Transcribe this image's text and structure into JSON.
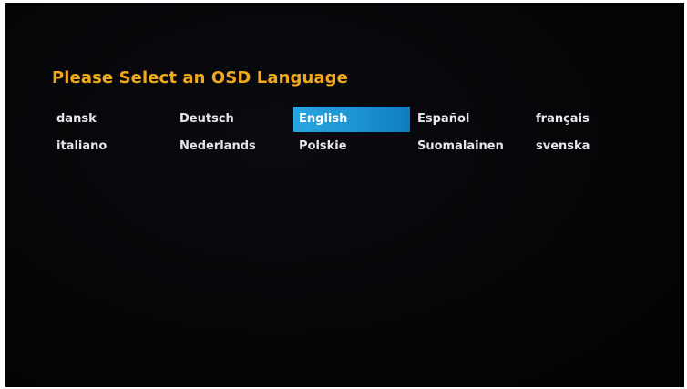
{
  "screen": {
    "title": "Please Select an OSD Language"
  },
  "languages": {
    "row1": [
      "dansk",
      "Deutsch",
      "English",
      "Español",
      "français"
    ],
    "row2": [
      "italiano",
      "Nederlands",
      "Polskie",
      "Suomalainen",
      "svenska"
    ]
  },
  "selected_language": "English",
  "colors": {
    "title": "#f0a81e",
    "highlight": "#1c93d1",
    "text": "#e4e6ec",
    "background": "#050507"
  }
}
